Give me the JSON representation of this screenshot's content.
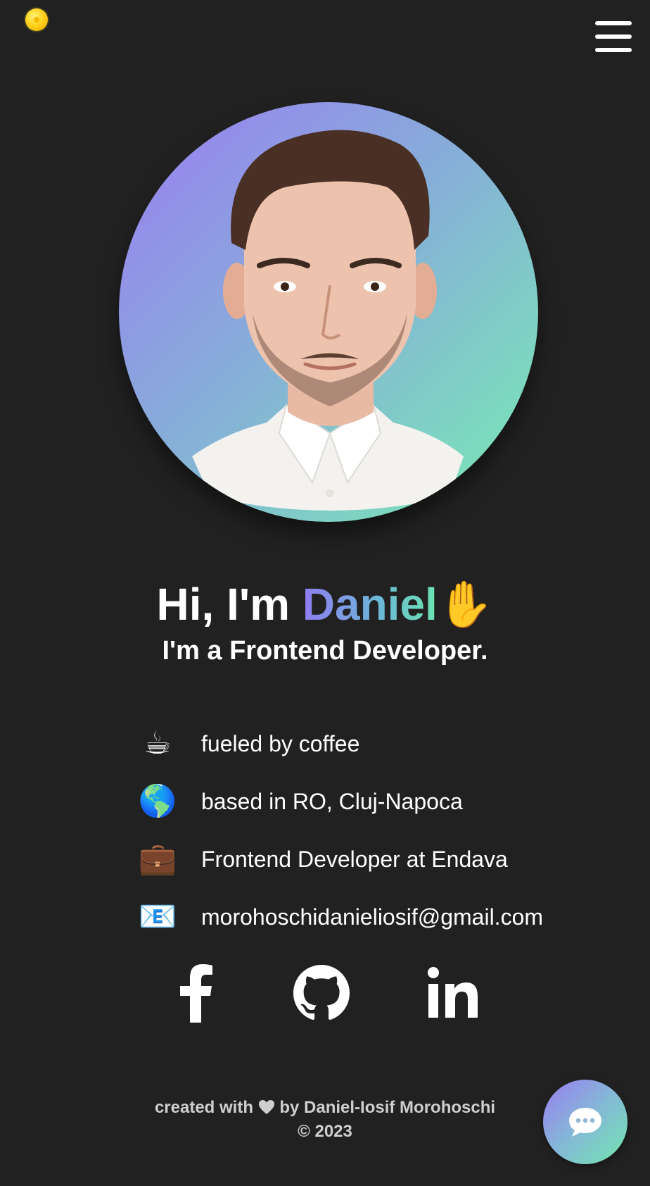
{
  "header": {
    "theme_toggle_icon": "sun-icon",
    "menu_icon": "hamburger-menu-icon"
  },
  "hero": {
    "avatar_icon": "profile-photo",
    "greeting_prefix": "Hi, I'm ",
    "greeting_name": "Daniel",
    "greeting_emoji": "✋",
    "subtitle": "I'm a Frontend Developer."
  },
  "info": [
    {
      "emoji": "☕",
      "icon": "coffee-icon",
      "text": "fueled by coffee"
    },
    {
      "emoji": "🌎",
      "icon": "globe-icon",
      "text": "based in RO, Cluj-Napoca"
    },
    {
      "emoji": "💼",
      "icon": "briefcase-icon",
      "text": "Frontend Developer at Endava"
    },
    {
      "emoji": "📧",
      "icon": "email-icon",
      "text": "morohoschidanieliosif@gmail.com"
    }
  ],
  "socials": [
    {
      "name": "facebook",
      "icon": "facebook-icon"
    },
    {
      "name": "github",
      "icon": "github-icon"
    },
    {
      "name": "linkedin",
      "icon": "linkedin-icon"
    }
  ],
  "footer": {
    "created_with": "created with",
    "by_line": "by Daniel-Iosif Morohoschi",
    "copyright": "© 2023"
  },
  "chat": {
    "icon": "chat-bubble-icon"
  },
  "colors": {
    "background": "#212121",
    "gradient_start": "#9a7df2",
    "gradient_mid": "#86b0d8",
    "gradient_end": "#78edb2",
    "text": "#ffffff",
    "footer_text": "#cfcfcf"
  }
}
